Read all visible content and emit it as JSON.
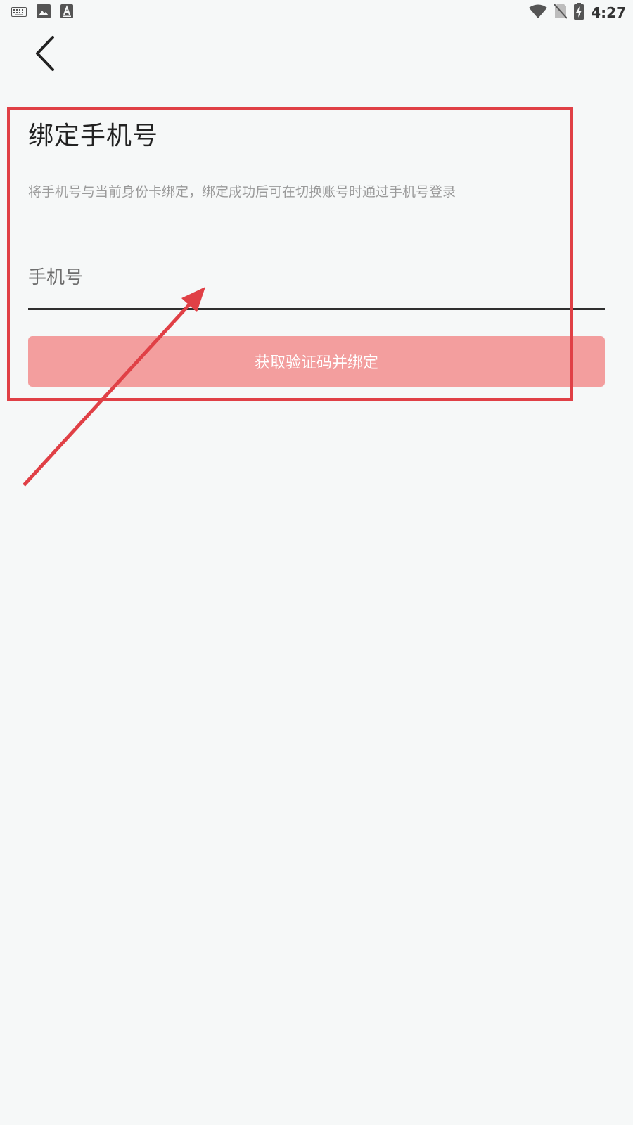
{
  "status_bar": {
    "time": "4:27",
    "left_icons": [
      "keyboard-icon",
      "image-icon",
      "font-icon"
    ],
    "right_icons": [
      "wifi-icon",
      "no-sim-icon",
      "battery-charging-icon"
    ]
  },
  "header": {
    "back_icon": "chevron-left-icon"
  },
  "main": {
    "title": "绑定手机号",
    "description": "将手机号与当前身份卡绑定，绑定成功后可在切换账号时通过手机号登录",
    "phone_input": {
      "placeholder": "手机号",
      "value": ""
    },
    "submit_label": "获取验证码并绑定"
  },
  "annotation": {
    "color": "#e04046"
  },
  "colors": {
    "background": "#f6f8f8",
    "button": "#f39e9e",
    "accent_red": "#e04046"
  }
}
